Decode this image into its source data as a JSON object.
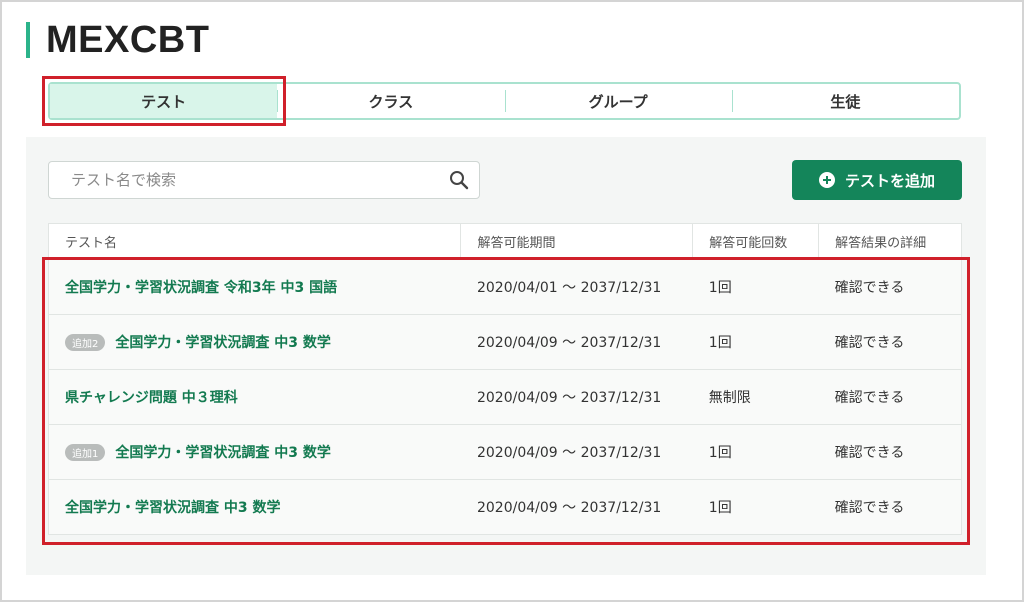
{
  "page": {
    "title": "MEXCBT"
  },
  "tabs": [
    {
      "label": "テスト",
      "active": true
    },
    {
      "label": "クラス",
      "active": false
    },
    {
      "label": "グループ",
      "active": false
    },
    {
      "label": "生徒",
      "active": false
    }
  ],
  "search": {
    "placeholder": "テスト名で検索",
    "value": ""
  },
  "toolbar": {
    "add_label": "テストを追加"
  },
  "table": {
    "headers": [
      "テスト名",
      "解答可能期間",
      "解答可能回数",
      "解答結果の詳細"
    ],
    "rows": [
      {
        "badge": "",
        "name": "全国学力・学習状況調査 令和3年 中3 国語",
        "period": "2020/04/01 〜 2037/12/31",
        "count": "1回",
        "detail": "確認できる"
      },
      {
        "badge": "追加2",
        "name": "全国学力・学習状況調査 中3 数学",
        "period": "2020/04/09 〜 2037/12/31",
        "count": "1回",
        "detail": "確認できる"
      },
      {
        "badge": "",
        "name": "県チャレンジ問題 中３理科",
        "period": "2020/04/09 〜 2037/12/31",
        "count": "無制限",
        "detail": "確認できる"
      },
      {
        "badge": "追加1",
        "name": "全国学力・学習状況調査 中3 数学",
        "period": "2020/04/09 〜 2037/12/31",
        "count": "1回",
        "detail": "確認できる"
      },
      {
        "badge": "",
        "name": "全国学力・学習状況調査 中3 数学",
        "period": "2020/04/09 〜 2037/12/31",
        "count": "1回",
        "detail": "確認できる"
      }
    ]
  },
  "colors": {
    "accent": "#14855a",
    "tab_active_bg": "#d9f5ea",
    "tab_border": "#a9e2cf",
    "highlight": "#d0202a"
  },
  "icons": {
    "search": "search-icon",
    "add": "plus-circle-icon"
  }
}
